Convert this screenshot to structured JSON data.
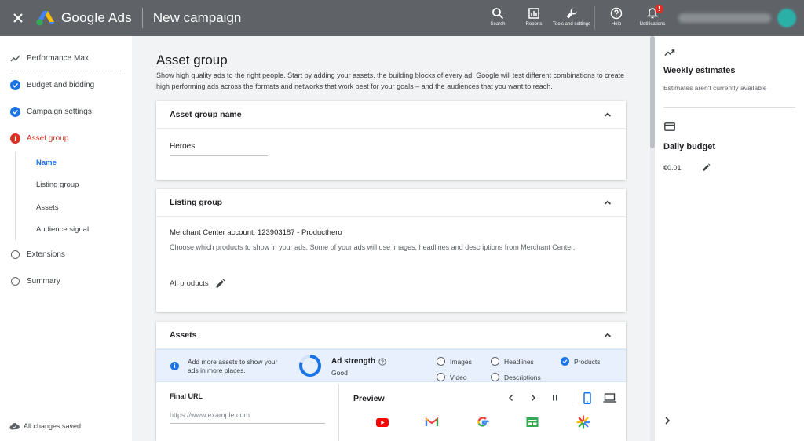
{
  "header": {
    "product_name": "Google Ads",
    "page_title": "New campaign",
    "tools": [
      {
        "label": "Search",
        "icon": "search-icon"
      },
      {
        "label": "Reports",
        "icon": "reports-icon"
      },
      {
        "label": "Tools and settings",
        "icon": "wrench-icon"
      },
      {
        "label": "Help",
        "icon": "help-icon"
      },
      {
        "label": "Notifications",
        "icon": "bell-icon",
        "badge": "!"
      }
    ]
  },
  "sidebar": {
    "items": [
      {
        "label": "Performance Max",
        "state": "trend"
      },
      {
        "label": "Budget and bidding",
        "state": "done"
      },
      {
        "label": "Campaign settings",
        "state": "done"
      },
      {
        "label": "Asset group",
        "state": "error"
      },
      {
        "label": "Extensions",
        "state": "todo"
      },
      {
        "label": "Summary",
        "state": "todo"
      }
    ],
    "subitems": [
      {
        "label": "Name",
        "active": true
      },
      {
        "label": "Listing group",
        "active": false
      },
      {
        "label": "Assets",
        "active": false
      },
      {
        "label": "Audience signal",
        "active": false
      }
    ],
    "save_status": "All changes saved"
  },
  "main": {
    "title": "Asset group",
    "intro": "Show high quality ads to the right people. Start by adding your assets, the building blocks of every ad. Google will test different combinations to create high performing ads across the formats and networks that work best for your goals – and the audiences that you want to reach.",
    "asset_group_name": {
      "header": "Asset group name",
      "value": "Heroes"
    },
    "listing_group": {
      "header": "Listing group",
      "merchant": "Merchant Center account: 123903187 - Producthero",
      "description": "Choose which products to show in your ads. Some of your ads will use images, headlines and descriptions from Merchant Center.",
      "selection": "All products"
    },
    "assets": {
      "header": "Assets",
      "info": "Add more assets to show your ads in more places.",
      "strength_label": "Ad strength",
      "strength_value": "Good",
      "strength_fraction": 0.8,
      "options": [
        {
          "label": "Images",
          "checked": false
        },
        {
          "label": "Headlines",
          "checked": false
        },
        {
          "label": "Products",
          "checked": true
        },
        {
          "label": "Video",
          "checked": false
        },
        {
          "label": "Descriptions",
          "checked": false
        }
      ],
      "final_url_label": "Final URL",
      "final_url_placeholder": "https://www.example.com",
      "preview_label": "Preview",
      "preview_apps": [
        "youtube-icon",
        "gmail-icon",
        "google-icon",
        "discover-icon",
        "display-icon"
      ]
    }
  },
  "right_panel": {
    "weekly_title": "Weekly estimates",
    "weekly_sub": "Estimates aren't currently available",
    "budget_title": "Daily budget",
    "budget_value": "€0.01"
  },
  "colors": {
    "header_bg": "#5f6368",
    "accent": "#1a73e8",
    "error": "#d93025",
    "info_bg": "#e8f0fe"
  }
}
